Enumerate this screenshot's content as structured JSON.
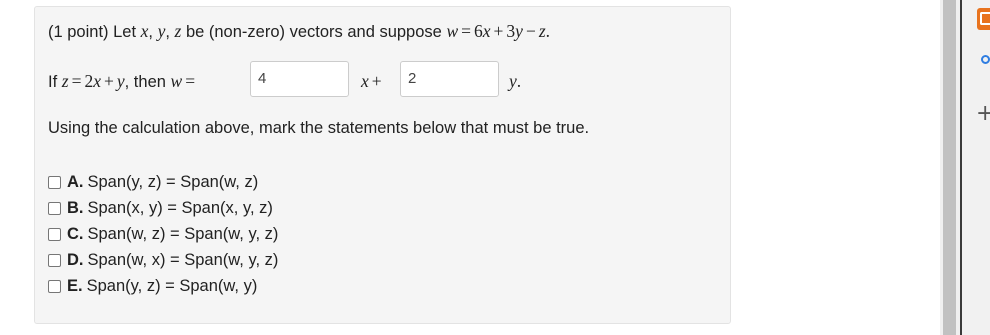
{
  "problem": {
    "line1": {
      "p1": "(1 point) Let ",
      "x": "x",
      "comma1": ", ",
      "y": "y",
      "comma2": ", ",
      "z": "z",
      "p2": " be (non-zero) vectors and suppose ",
      "w": "w",
      "eq": "=",
      "six": "6",
      "x2": "x",
      "plus": "+",
      "three": "3",
      "y2": "y",
      "minus": "−",
      "z2": "z",
      "dot": "."
    },
    "line2": {
      "if": "If ",
      "z": "z",
      "eq": "=",
      "two": "2",
      "x": "x",
      "plus": "+",
      "y": "y",
      "then": ", then ",
      "w": "w",
      "eq2": "=",
      "answer1": "4",
      "xplus_x": "x",
      "xplus_plus": "+",
      "answer2": "2",
      "ydot_y": "y",
      "ydot_dot": "."
    },
    "instruction": "Using the calculation above, mark the statements below that must be true.",
    "options": [
      {
        "letter": "A.",
        "text": "Span(y, z) = Span(w, z)",
        "checked": false
      },
      {
        "letter": "B.",
        "text": "Span(x, y) = Span(x, y, z)",
        "checked": false
      },
      {
        "letter": "C.",
        "text": "Span(w, z) = Span(w, y, z)",
        "checked": false
      },
      {
        "letter": "D.",
        "text": "Span(w, x) = Span(w, y, z)",
        "checked": false
      },
      {
        "letter": "E.",
        "text": "Span(y, z) = Span(w, y)",
        "checked": false
      }
    ]
  },
  "sidebar": {
    "icons": [
      "extension-icon",
      "status-dot-icon",
      "plus-icon"
    ],
    "plus": "+",
    "accent": "#e8731e",
    "dot_color": "#2f7de1"
  }
}
